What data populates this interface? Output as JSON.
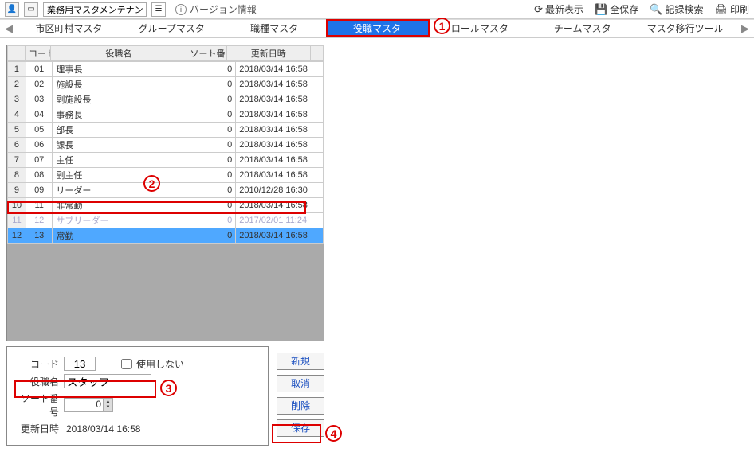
{
  "topbar": {
    "title_input": "業務用マスタメンテナンス",
    "version_info": "バージョン情報",
    "refresh": "最新表示",
    "save_all": "全保存",
    "search_log": "記録検索",
    "print": "印刷"
  },
  "tabs": {
    "items": [
      {
        "label": "市区町村マスタ"
      },
      {
        "label": "グループマスタ"
      },
      {
        "label": "職種マスタ"
      },
      {
        "label": "役職マスタ",
        "active": true
      },
      {
        "label": "ロールマスタ"
      },
      {
        "label": "チームマスタ"
      },
      {
        "label": "マスタ移行ツール"
      }
    ]
  },
  "grid": {
    "headers": {
      "code": "コード",
      "name": "役職名",
      "sort": "ソート番号",
      "date": "更新日時"
    },
    "rows": [
      {
        "idx": "1",
        "code": "01",
        "name": "理事長",
        "sort": "0",
        "date": "2018/03/14 16:58"
      },
      {
        "idx": "2",
        "code": "02",
        "name": "施設長",
        "sort": "0",
        "date": "2018/03/14 16:58"
      },
      {
        "idx": "3",
        "code": "03",
        "name": "副施設長",
        "sort": "0",
        "date": "2018/03/14 16:58"
      },
      {
        "idx": "4",
        "code": "04",
        "name": "事務長",
        "sort": "0",
        "date": "2018/03/14 16:58"
      },
      {
        "idx": "5",
        "code": "05",
        "name": "部長",
        "sort": "0",
        "date": "2018/03/14 16:58"
      },
      {
        "idx": "6",
        "code": "06",
        "name": "課長",
        "sort": "0",
        "date": "2018/03/14 16:58"
      },
      {
        "idx": "7",
        "code": "07",
        "name": "主任",
        "sort": "0",
        "date": "2018/03/14 16:58"
      },
      {
        "idx": "8",
        "code": "08",
        "name": "副主任",
        "sort": "0",
        "date": "2018/03/14 16:58"
      },
      {
        "idx": "9",
        "code": "09",
        "name": "リーダー",
        "sort": "0",
        "date": "2010/12/28 16:30"
      },
      {
        "idx": "10",
        "code": "11",
        "name": "非常勤",
        "sort": "0",
        "date": "2018/03/14 16:58"
      },
      {
        "idx": "11",
        "code": "12",
        "name": "サブリーダー",
        "sort": "0",
        "date": "2017/02/01 11:24",
        "faded": true
      },
      {
        "idx": "12",
        "code": "13",
        "name": "常勤",
        "sort": "0",
        "date": "2018/03/14 16:58",
        "selected": true
      }
    ]
  },
  "form": {
    "code_label": "コード",
    "code_value": "13",
    "disable_label": "使用しない",
    "name_label": "役職名",
    "name_value": "スタッフ",
    "sort_label": "ソート番号",
    "sort_value": "0",
    "date_label": "更新日時",
    "date_value": "2018/03/14 16:58"
  },
  "buttons": {
    "new": "新規",
    "cancel": "取消",
    "delete": "削除",
    "save": "保存"
  },
  "annot": {
    "a1": "1",
    "a2": "2",
    "a3": "3",
    "a4": "4"
  }
}
